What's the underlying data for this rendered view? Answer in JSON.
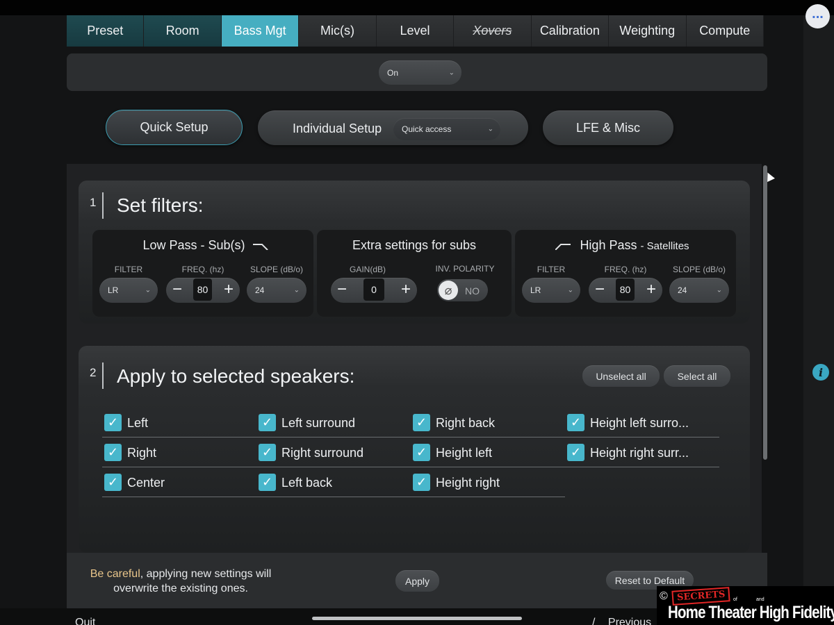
{
  "tabs": [
    {
      "label": "Preset",
      "state": "done"
    },
    {
      "label": "Room",
      "state": "done"
    },
    {
      "label": "Bass Mgt",
      "state": "active"
    },
    {
      "label": "Mic(s)",
      "state": "normal"
    },
    {
      "label": "Level",
      "state": "normal"
    },
    {
      "label": "Xovers",
      "state": "struck"
    },
    {
      "label": "Calibration",
      "state": "normal"
    },
    {
      "label": "Weighting",
      "state": "normal"
    },
    {
      "label": "Compute",
      "state": "normal"
    }
  ],
  "bass_mode": {
    "value": "On"
  },
  "modes": {
    "quick_setup": "Quick Setup",
    "individual_setup": "Individual Setup",
    "quick_access": "Quick access",
    "lfe_misc": "LFE & Misc"
  },
  "section1": {
    "number": "1",
    "title": "Set filters:",
    "low_pass": {
      "title": "Low Pass - Sub(s)",
      "filter_label": "FILTER",
      "filter_value": "LR",
      "freq_label": "FREQ. (hz)",
      "freq_value": "80",
      "slope_label": "SLOPE (dB/o)",
      "slope_value": "24"
    },
    "extra": {
      "title": "Extra settings for subs",
      "gain_label": "GAIN(dB)",
      "gain_value": "0",
      "polarity_label": "INV. POLARITY",
      "polarity_value": "NO"
    },
    "high_pass": {
      "title": "High Pass",
      "subtitle": "Satellites",
      "filter_label": "FILTER",
      "filter_value": "LR",
      "freq_label": "FREQ. (hz)",
      "freq_value": "80",
      "slope_label": "SLOPE (dB/o)",
      "slope_value": "24"
    }
  },
  "section2": {
    "number": "2",
    "title": "Apply to selected speakers:",
    "unselect_all": "Unselect all",
    "select_all": "Select all",
    "speakers": [
      {
        "label": "Left",
        "checked": true
      },
      {
        "label": "Right",
        "checked": true
      },
      {
        "label": "Center",
        "checked": true
      },
      {
        "label": "Left surround",
        "checked": true
      },
      {
        "label": "Right surround",
        "checked": true
      },
      {
        "label": "Left back",
        "checked": true
      },
      {
        "label": "Right back",
        "checked": true
      },
      {
        "label": "Height left",
        "checked": true
      },
      {
        "label": "Height right",
        "checked": true
      },
      {
        "label": "Height left surro...",
        "checked": true
      },
      {
        "label": "Height right surr...",
        "checked": true
      }
    ]
  },
  "footer": {
    "warning_highlight": "Be careful",
    "warning_rest": ", applying new settings will",
    "warning_line2": "overwrite the existing ones.",
    "apply": "Apply",
    "reset": "Reset to Default"
  },
  "bottom_nav": {
    "quit": "Quit",
    "previous": "Previous"
  },
  "top": {
    "more_glyph": "..."
  },
  "info_glyph": "i",
  "icons": {
    "check": "✓",
    "chevron": "⌄",
    "minus": "−",
    "plus": "+",
    "polarity": "⌀"
  },
  "watermark": {
    "copyright": "©",
    "secrets": "SECRETS",
    "of": "of",
    "and": "and",
    "main": "Home Theater High Fidelity"
  },
  "colors": {
    "accent": "#46aec1",
    "done_tab": "#1f4a50",
    "warning": "#e8c58a",
    "checkbox": "#48b7cc"
  }
}
